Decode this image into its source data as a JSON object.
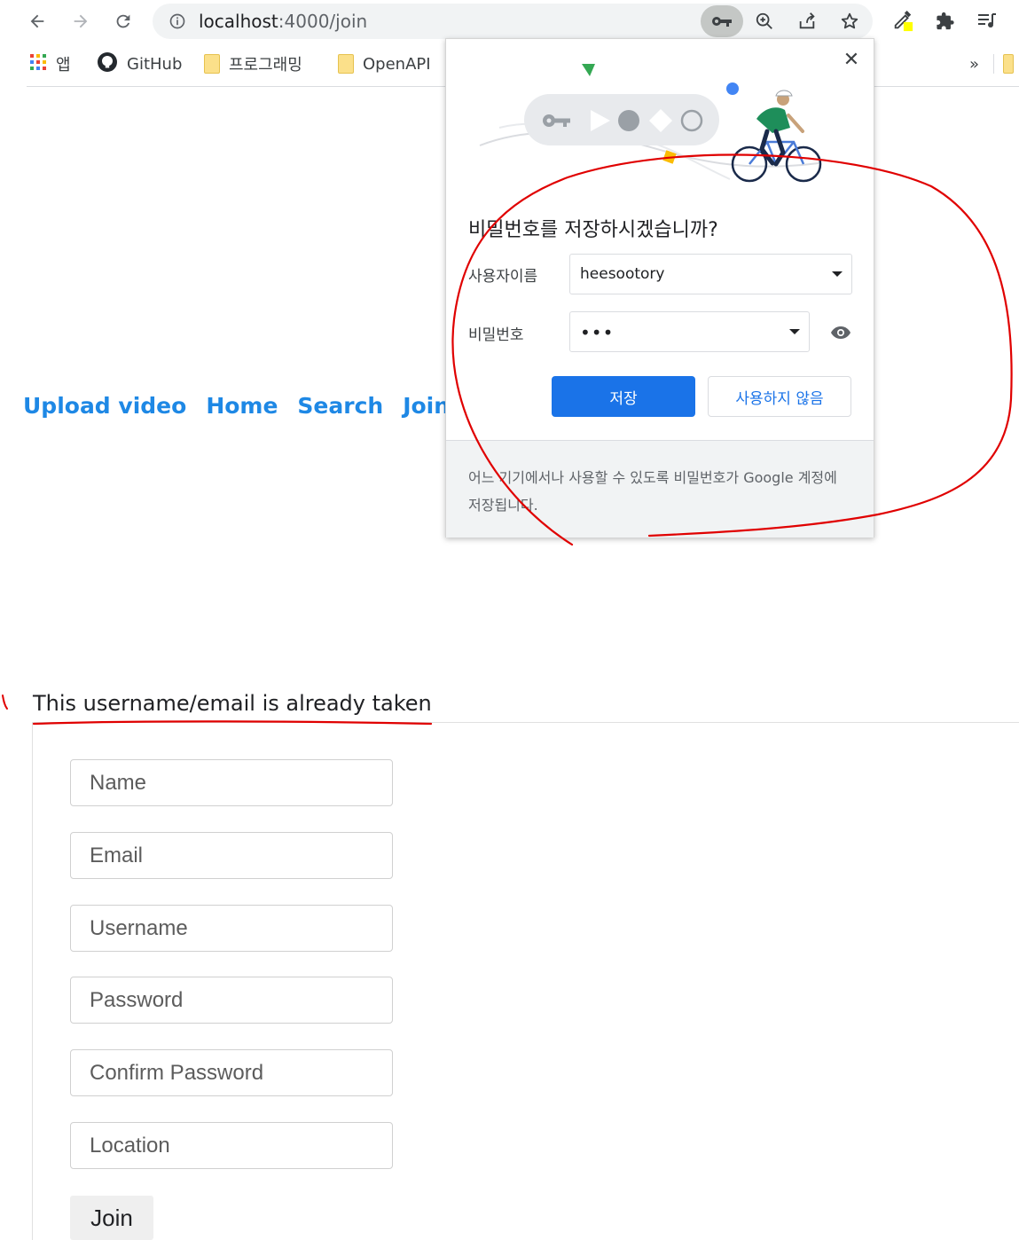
{
  "browser": {
    "url_host": "localhost",
    "url_path": ":4000/join",
    "icons": [
      "back-icon",
      "forward-icon",
      "reload-icon",
      "info-icon",
      "key-icon",
      "zoom-icon",
      "share-icon",
      "star-icon",
      "eyedropper-icon",
      "extensions-icon",
      "media-icon"
    ]
  },
  "bookmarks": {
    "items": [
      {
        "label": "앱",
        "icon": "apps-icon"
      },
      {
        "label": "GitHub",
        "icon": "github-icon"
      },
      {
        "label": "프로그래밍",
        "icon": "folder-icon"
      },
      {
        "label": "OpenAPI",
        "icon": "folder-icon"
      }
    ],
    "overflow_label": "»"
  },
  "nav": {
    "links": [
      "Upload video",
      "Home",
      "Search",
      "Join"
    ]
  },
  "password_popup": {
    "title": "비밀번호를 저장하시겠습니까?",
    "username_label": "사용자이름",
    "username_value": "heesootory",
    "password_label": "비밀번호",
    "password_value": "•••",
    "save_button": "저장",
    "never_button": "사용하지 않음",
    "footer_text": "어느 기기에서나 사용할 수 있도록 비밀번호가 Google 계정에 저장됩니다."
  },
  "join_form": {
    "error_message": "This username/email is already taken",
    "placeholders": {
      "name": "Name",
      "email": "Email",
      "username": "Username",
      "password": "Password",
      "confirm_password": "Confirm Password",
      "location": "Location"
    },
    "submit_label": "Join"
  },
  "colors": {
    "nav_link": "#1e88e5",
    "primary_button": "#1a73e8",
    "annotation": "#e00000"
  }
}
